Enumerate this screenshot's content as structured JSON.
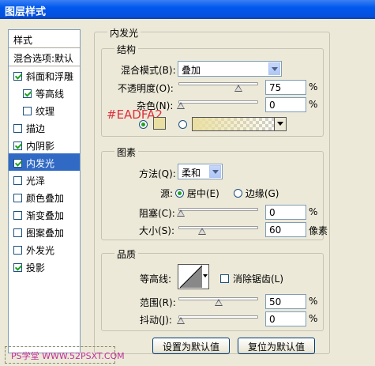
{
  "window": {
    "title": "图层样式"
  },
  "left_panel": {
    "header": "样式",
    "blend_options": "混合选项:默认",
    "items": [
      {
        "label": "斜面和浮雕",
        "checked": true,
        "indent": false,
        "selected": false
      },
      {
        "label": "等高线",
        "checked": true,
        "indent": true,
        "selected": false
      },
      {
        "label": "纹理",
        "checked": false,
        "indent": true,
        "selected": false
      },
      {
        "label": "描边",
        "checked": false,
        "indent": false,
        "selected": false
      },
      {
        "label": "内阴影",
        "checked": true,
        "indent": false,
        "selected": false
      },
      {
        "label": "内发光",
        "checked": true,
        "indent": false,
        "selected": true
      },
      {
        "label": "光泽",
        "checked": false,
        "indent": false,
        "selected": false
      },
      {
        "label": "颜色叠加",
        "checked": false,
        "indent": false,
        "selected": false
      },
      {
        "label": "渐变叠加",
        "checked": false,
        "indent": false,
        "selected": false
      },
      {
        "label": "图案叠加",
        "checked": false,
        "indent": false,
        "selected": false
      },
      {
        "label": "外发光",
        "checked": false,
        "indent": false,
        "selected": false
      },
      {
        "label": "投影",
        "checked": true,
        "indent": false,
        "selected": false
      }
    ]
  },
  "section_title": "内发光",
  "structure": {
    "title": "结构",
    "blend_mode_label": "混合模式(B):",
    "blend_mode_value": "叠加",
    "opacity_label": "不透明度(O):",
    "opacity_value": "75",
    "opacity_unit": "%",
    "noise_label": "杂色(N):",
    "noise_value": "0",
    "noise_unit": "%",
    "color_annotation": "#EADFA2",
    "swatch_color": "#eadfa2",
    "annotation_color": "#e0303c"
  },
  "elements": {
    "title": "图素",
    "method_label": "方法(Q):",
    "method_value": "柔和",
    "source_label": "源:",
    "source_center": "居中(E)",
    "source_edge": "边缘(G)",
    "choke_label": "阻塞(C):",
    "choke_value": "0",
    "choke_unit": "%",
    "size_label": "大小(S):",
    "size_value": "60",
    "size_unit": "像素"
  },
  "quality": {
    "title": "品质",
    "contour_label": "等高线:",
    "antialias_label": "消除锯齿(L)",
    "range_label": "范围(R):",
    "range_value": "50",
    "range_unit": "%",
    "jitter_label": "抖动(J):",
    "jitter_value": "0",
    "jitter_unit": "%"
  },
  "buttons": {
    "make_default": "设置为默认值",
    "reset_default": "复位为默认值"
  },
  "watermark": "PS学堂 WWW.52PSXT.COM"
}
